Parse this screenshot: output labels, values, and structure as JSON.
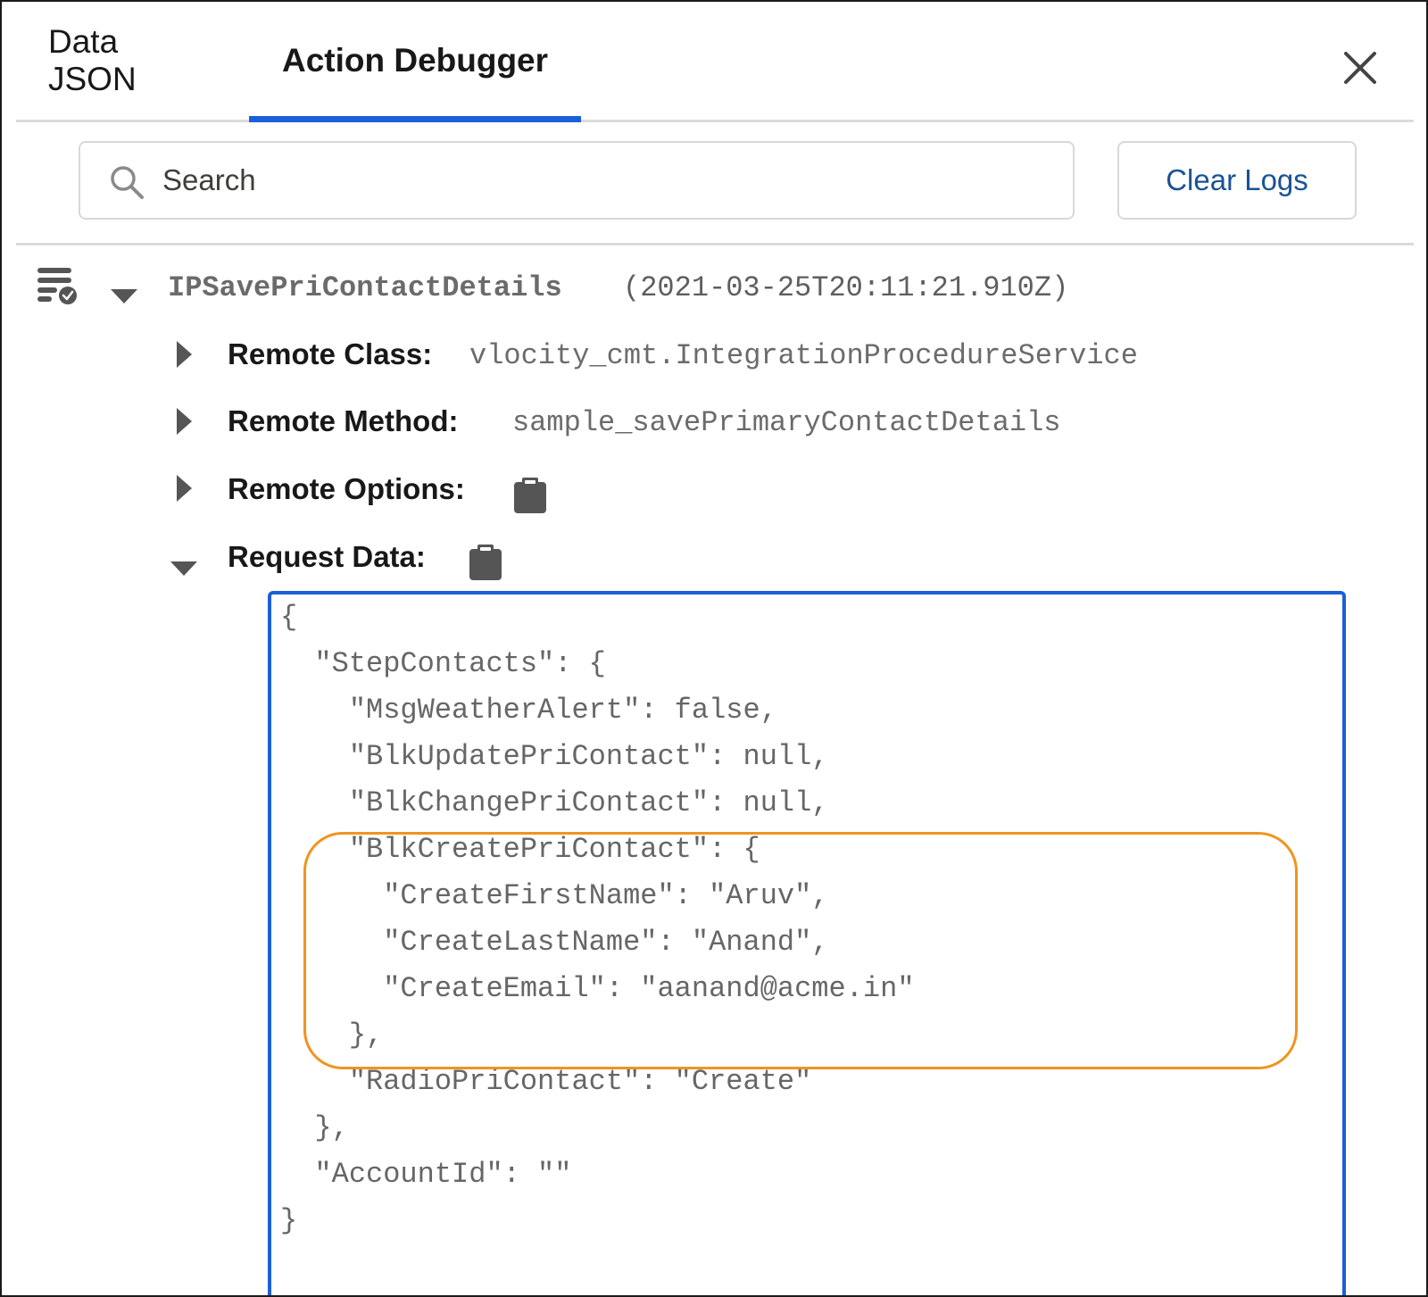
{
  "tabs": {
    "data_json": "Data JSON",
    "action_debugger": "Action Debugger"
  },
  "search": {
    "placeholder": "Search"
  },
  "toolbar": {
    "clear_logs": "Clear Logs"
  },
  "log_entry": {
    "name": "IPSavePriContactDetails",
    "timestamp": "(2021-03-25T20:11:21.910Z)",
    "remote_class_label": "Remote Class:",
    "remote_class_value": "vlocity_cmt.IntegrationProcedureService",
    "remote_method_label": "Remote Method:",
    "remote_method_value": "sample_savePrimaryContactDetails",
    "remote_options_label": "Remote Options:",
    "request_data_label": "Request Data:"
  },
  "request_json": {
    "lines": [
      "{",
      "  \"StepContacts\": {",
      "    \"MsgWeatherAlert\": false,",
      "    \"BlkUpdatePriContact\": null,",
      "    \"BlkChangePriContact\": null,",
      "    \"BlkCreatePriContact\": {",
      "      \"CreateFirstName\": \"Aruv\",",
      "      \"CreateLastName\": \"Anand\",",
      "      \"CreateEmail\": \"aanand@acme.in\"",
      "    },",
      "    \"RadioPriContact\": \"Create\"",
      "  },",
      "  \"AccountId\": \"\"",
      "}"
    ]
  },
  "icons": {
    "close": "close-icon",
    "search": "search-icon",
    "log": "log-list-check-icon",
    "clipboard": "clipboard-icon"
  },
  "colors": {
    "accent": "#1b5fd9",
    "link": "#1b5297",
    "highlight": "#f0941f"
  }
}
